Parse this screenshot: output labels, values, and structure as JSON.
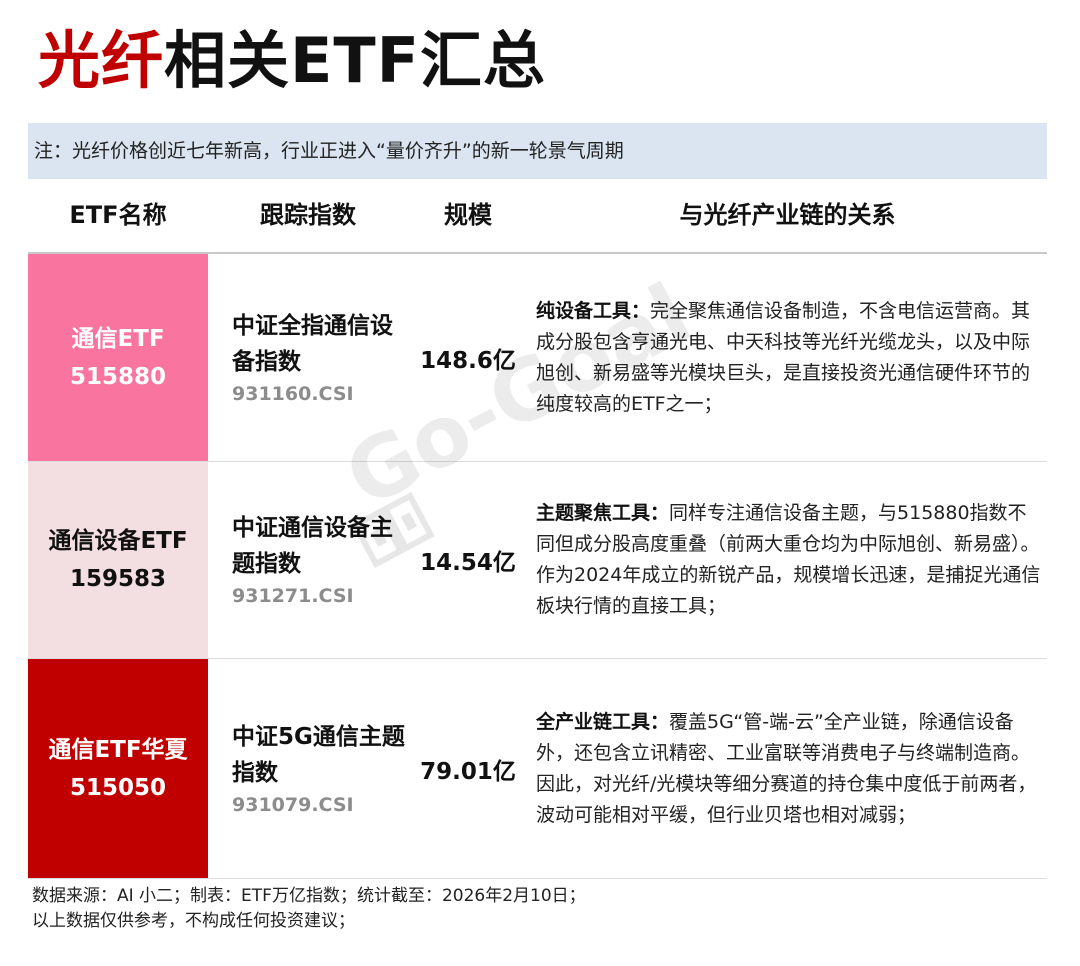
{
  "title": {
    "highlight": "光纤",
    "rest": "相关ETF汇总"
  },
  "note": "注：光纤价格创近七年新高，行业正进入“量价齐升”的新一轮景气周期",
  "columns": [
    "ETF名称",
    "跟踪指数",
    "规模",
    "与光纤产业链的关系"
  ],
  "rows": [
    {
      "etf_name": "通信ETF",
      "etf_code": "515880",
      "index_name": "中证全指通信设备指数",
      "index_code": "931160.CSI",
      "scale": "148.6亿",
      "relation_lead": "纯设备工具：",
      "relation_text": "完全聚焦通信设备制造，不含电信运营商。其成分股包含亨通光电、中天科技等光纤光缆龙头，以及中际旭创、新易盛等光模块巨头，是直接投资光通信硬件环节的纯度较高的ETF之一；",
      "bg": "#f9749f",
      "fg": "#ffffff"
    },
    {
      "etf_name": "通信设备ETF",
      "etf_code": "159583",
      "index_name": "中证通信设备主题指数",
      "index_code": "931271.CSI",
      "scale": "14.54亿",
      "relation_lead": "主题聚焦工具：",
      "relation_text": "同样专注通信设备主题，与515880指数不同但成分股高度重叠（前两大重仓均为中际旭创、新易盛）。作为2024年成立的新锐产品，规模增长迅速，是捕捉光通信板块行情的直接工具；",
      "bg": "#f3dfe1",
      "fg": "#111111"
    },
    {
      "etf_name": "通信ETF华夏",
      "etf_code": "515050",
      "index_name": "中证5G通信主题指数",
      "index_code": "931079.CSI",
      "scale": "79.01亿",
      "relation_lead": "全产业链工具：",
      "relation_text": "覆盖5G“管-端-云”全产业链，除通信设备外，还包含立讯精密、工业富联等消费电子与终端制造商。因此，对光纤/光模块等细分赛道的持仓集中度低于前两者，波动可能相对平缓，但行业贝塔也相对减弱；",
      "bg": "#c00000",
      "fg": "#ffffff"
    }
  ],
  "watermark": "Go-Goal",
  "footer": {
    "line1": "数据来源：AI 小二；制表：ETF万亿指数；统计截至：2026年2月10日；",
    "line2": "以上数据仅供参考，不构成任何投资建议；"
  }
}
